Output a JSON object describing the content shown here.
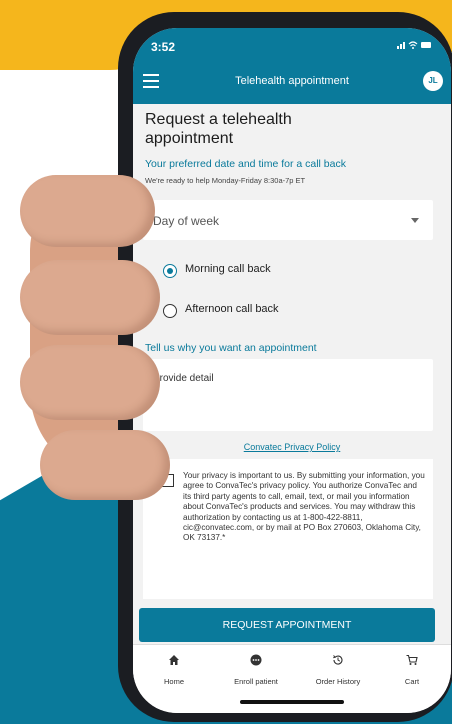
{
  "status_bar": {
    "time": "3:52",
    "icons": "signal-wifi-battery"
  },
  "app_bar": {
    "menu_icon": "hamburger-menu-icon",
    "title": "Telehealth appointment",
    "avatar_initials": "JL"
  },
  "form": {
    "title": "Request a telehealth appointment",
    "subtitle": "Your preferred date and time for a call back",
    "hours_note": "We're ready to help Monday-Friday 8:30a-7p ET",
    "day_select": {
      "value": "Day of week"
    },
    "callback_options": [
      {
        "label": "Morning call back",
        "selected": true
      },
      {
        "label": "Afternoon call back",
        "selected": false
      }
    ],
    "reason_label": "Tell us why you want an appointment",
    "reason_placeholder": "Provide detail",
    "privacy_link": "Convatec Privacy Policy",
    "consent_text": "Your privacy is important to us. By submitting your information, you agree to ConvaTec's privacy policy. You authorize ConvaTec and its third party agents to call, email, text, or mail you information about ConvaTec's products and services. You may withdraw this authorization by contacting us at 1-800-422-8811, cic@convatec.com, or by mail at PO Box 270603, Oklahoma City, OK 73137.*",
    "consent_checked": false,
    "submit_label": "REQUEST APPOINTMENT"
  },
  "tab_bar": [
    {
      "label": "Home",
      "icon": "home-icon"
    },
    {
      "label": "Enroll patient",
      "icon": "enroll-icon"
    },
    {
      "label": "Order History",
      "icon": "history-icon"
    },
    {
      "label": "Cart",
      "icon": "cart-icon"
    }
  ],
  "colors": {
    "brand_teal": "#0a7a9b",
    "accent_yellow": "#f5b61c",
    "screen_bg": "#f2f2f2"
  }
}
